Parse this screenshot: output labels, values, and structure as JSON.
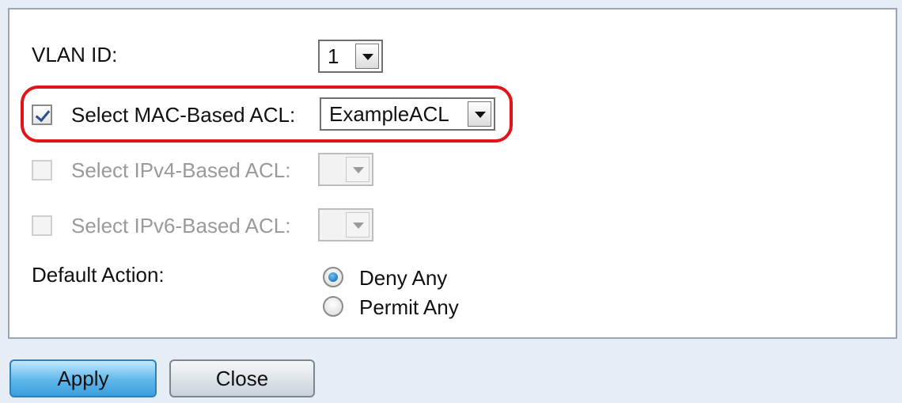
{
  "form": {
    "vlan_id_label": "VLAN ID:",
    "vlan_id_value": "1",
    "mac_acl": {
      "label": "Select MAC-Based ACL:",
      "checked": true,
      "value": "ExampleACL"
    },
    "ipv4_acl": {
      "label": "Select IPv4-Based ACL:",
      "checked": false,
      "enabled": false,
      "value": ""
    },
    "ipv6_acl": {
      "label": "Select IPv6-Based ACL:",
      "checked": false,
      "enabled": false,
      "value": ""
    },
    "default_action_label": "Default Action:",
    "default_action_options": [
      {
        "label": "Deny Any",
        "selected": true
      },
      {
        "label": "Permit Any",
        "selected": false
      }
    ]
  },
  "buttons": {
    "apply": "Apply",
    "close": "Close"
  },
  "colors": {
    "highlight": "#e1141a",
    "apply": "#5fb6ea",
    "background": "#e7edf4"
  },
  "icons": {
    "checkbox_checked": "check-icon",
    "dropdown": "chevron-down-icon",
    "radio": "radio-dot-icon"
  }
}
